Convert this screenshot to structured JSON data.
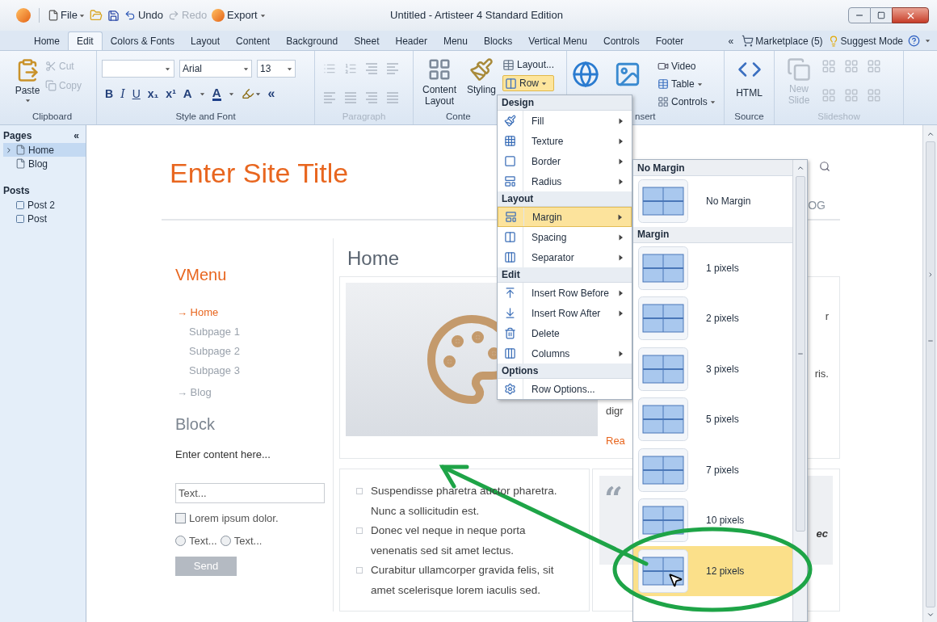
{
  "window": {
    "title": "Untitled - Artisteer 4 Standard Edition"
  },
  "quick_access": {
    "file": "File",
    "undo": "Undo",
    "redo": {
      "label": "Redo",
      "disabled": true
    },
    "export": "Export"
  },
  "tabs": [
    {
      "label": "Home",
      "selected": false
    },
    {
      "label": "Edit",
      "selected": true
    },
    {
      "label": "Colors & Fonts",
      "selected": false
    },
    {
      "label": "Layout",
      "selected": false
    },
    {
      "label": "Content",
      "selected": false
    },
    {
      "label": "Background",
      "selected": false
    },
    {
      "label": "Sheet",
      "selected": false
    },
    {
      "label": "Header",
      "selected": false
    },
    {
      "label": "Menu",
      "selected": false
    },
    {
      "label": "Blocks",
      "selected": false
    },
    {
      "label": "Vertical Menu",
      "selected": false
    },
    {
      "label": "Controls",
      "selected": false
    },
    {
      "label": "Footer",
      "selected": false
    }
  ],
  "tab_extras": {
    "collapse": "«",
    "marketplace": "Marketplace (5)",
    "suggest_mode": "Suggest Mode"
  },
  "ribbon": {
    "clipboard": {
      "label": "Clipboard",
      "paste": "Paste",
      "cut": {
        "label": "Cut",
        "disabled": true
      },
      "copy": {
        "label": "Copy",
        "disabled": true
      }
    },
    "style_font": {
      "label": "Style and Font",
      "font": "Arial",
      "size": "13",
      "format_buttons": [
        {
          "label": "B",
          "kind": "bold"
        },
        {
          "label": "I",
          "kind": "italic"
        },
        {
          "label": "U",
          "kind": "underline"
        },
        {
          "label": "x₁",
          "kind": "subscript"
        },
        {
          "label": "x¹",
          "kind": "superscript"
        },
        {
          "label": "A",
          "kind": "grow"
        },
        {
          "label": "A",
          "kind": "color"
        },
        {
          "label": "«",
          "kind": "quote"
        }
      ]
    },
    "paragraph": {
      "label": "Paragraph",
      "disabled": true
    },
    "content": {
      "label": "Conte",
      "content_layout": "Content Layout",
      "styling": "Styling",
      "layout": "Layout...",
      "row": {
        "label": "Row",
        "open": true
      }
    },
    "insert": {
      "label": "nsert",
      "video": "Video",
      "table": "Table",
      "controls": "Controls"
    },
    "source": {
      "label": "Source",
      "html": "HTML"
    },
    "slideshow": {
      "label": "Slideshow",
      "new_slide": "New Slide",
      "disabled": true
    }
  },
  "pages_panel": {
    "pages_title": "Pages",
    "collapse": "«",
    "pages": [
      {
        "label": "Home",
        "selected": true,
        "expanded": false
      },
      {
        "label": "Blog",
        "selected": false
      }
    ],
    "posts_title": "Posts",
    "posts": [
      {
        "label": "Post 2",
        "selected": false
      },
      {
        "label": "Post",
        "selected": false
      }
    ]
  },
  "preview": {
    "site_title": "Enter Site Title",
    "nav_fragment": "OG",
    "vmenu": {
      "title": "VMenu",
      "items": [
        {
          "label": "→ Home",
          "selected": true,
          "children": [
            {
              "label": "Subpage 1"
            },
            {
              "label": "Subpage 2"
            },
            {
              "label": "Subpage 3"
            }
          ]
        },
        {
          "label": "→ Blog",
          "selected": false
        }
      ]
    },
    "block": {
      "title": "Block",
      "text": "Enter content here...",
      "input_placeholder": "Text...",
      "checkbox": {
        "label": "Lorem ipsum dolor.",
        "checked": false
      },
      "radios": [
        {
          "label": "Text...",
          "selected": false
        },
        {
          "label": "Text...",
          "selected": false
        }
      ],
      "button": "Send"
    },
    "heading": "Home",
    "post": {
      "fragments": [
        "r",
        "ris."
      ],
      "text_fragment": "digr",
      "link_fragment": "Rea"
    },
    "list": [
      "Suspendisse pharetra auctor pharetra. Nunc a sollicitudin est.",
      "Donec vel neque in neque porta venenatis sed sit amet lectus.",
      "Curabitur ullamcorper gravida felis, sit amet scelerisque lorem iaculis sed."
    ],
    "quote": {
      "mark": "“",
      "fragment": "ec"
    }
  },
  "row_menu": {
    "sections": [
      {
        "title": "Design",
        "items": [
          {
            "label": "Fill",
            "submenu": true,
            "highlighted": false
          },
          {
            "label": "Texture",
            "submenu": true,
            "highlighted": false
          },
          {
            "label": "Border",
            "submenu": true,
            "highlighted": false
          },
          {
            "label": "Radius",
            "submenu": true,
            "highlighted": false
          }
        ]
      },
      {
        "title": "Layout",
        "items": [
          {
            "label": "Margin",
            "submenu": true,
            "highlighted": true
          },
          {
            "label": "Spacing",
            "submenu": true,
            "highlighted": false
          },
          {
            "label": "Separator",
            "submenu": true,
            "highlighted": false
          }
        ]
      },
      {
        "title": "Edit",
        "items": [
          {
            "label": "Insert Row Before",
            "submenu": true,
            "highlighted": false
          },
          {
            "label": "Insert Row After",
            "submenu": true,
            "highlighted": false
          },
          {
            "label": "Delete",
            "submenu": false,
            "highlighted": false
          },
          {
            "label": "Columns",
            "submenu": true,
            "highlighted": false
          }
        ]
      },
      {
        "title": "Options",
        "items": [
          {
            "label": "Row Options...",
            "submenu": false,
            "highlighted": false
          }
        ]
      }
    ]
  },
  "margin_submenu": {
    "sections": [
      {
        "title": "No Margin",
        "items": [
          {
            "label": "No Margin",
            "highlighted": false
          }
        ]
      },
      {
        "title": "Margin",
        "items": [
          {
            "label": "1 pixels",
            "highlighted": false
          },
          {
            "label": "2 pixels",
            "highlighted": false
          },
          {
            "label": "3 pixels",
            "highlighted": false
          },
          {
            "label": "5 pixels",
            "highlighted": false
          },
          {
            "label": "7 pixels",
            "highlighted": false
          },
          {
            "label": "10 pixels",
            "highlighted": false
          },
          {
            "label": "12 pixels",
            "highlighted": true
          }
        ]
      }
    ]
  }
}
